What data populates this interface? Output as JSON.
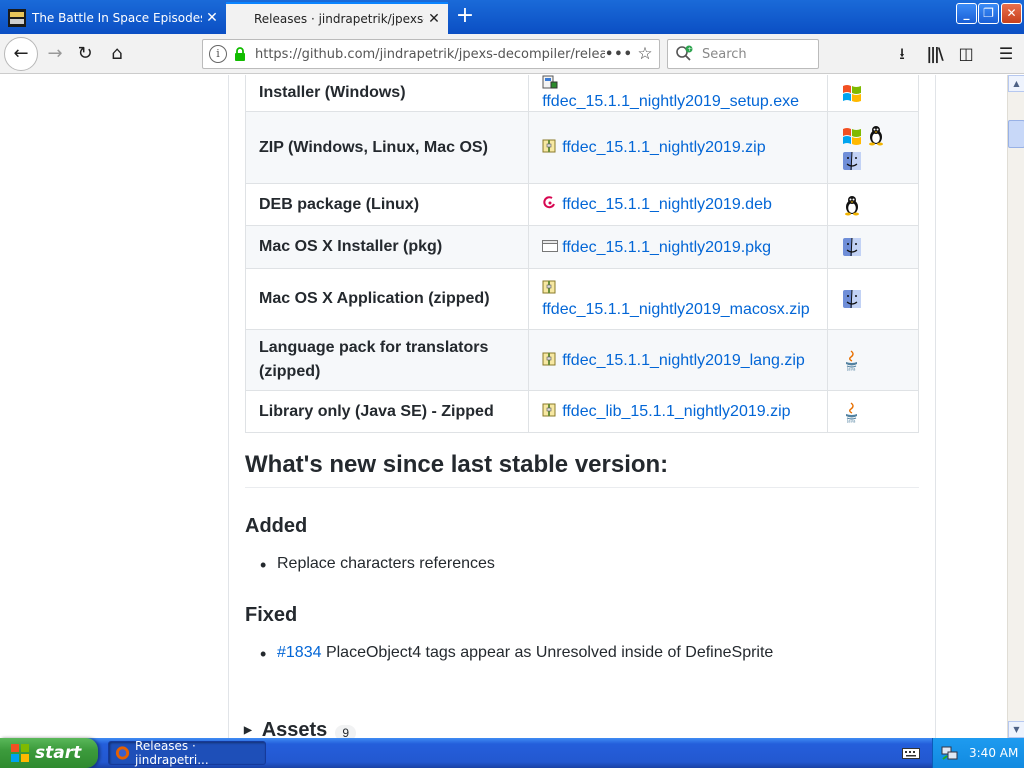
{
  "browser": {
    "tabs": [
      {
        "title": "The Battle In Space Episodes | Ob",
        "active": false
      },
      {
        "title": "Releases · jindrapetrik/jpexs-deco",
        "active": true
      }
    ],
    "url": "https://github.com/jindrapetrik/jpexs-decompiler/relea",
    "search_placeholder": "Search",
    "more_label": "•••"
  },
  "downloads": [
    {
      "label": "Installer (Windows)",
      "file": "ffdec_15.1.1_nightly2019_setup.exe",
      "file_icon": "installer-icon",
      "os_icons": [
        "windows-icon"
      ]
    },
    {
      "label": "ZIP (Windows, Linux, Mac OS)",
      "file": "ffdec_15.1.1_nightly2019.zip",
      "file_icon": "zip-icon",
      "os_icons": [
        "windows-icon",
        "linux-icon",
        "mac-icon"
      ]
    },
    {
      "label": "DEB package (Linux)",
      "file": "ffdec_15.1.1_nightly2019.deb",
      "file_icon": "debian-icon",
      "os_icons": [
        "linux-icon"
      ]
    },
    {
      "label": "Mac OS X Installer (pkg)",
      "file": "ffdec_15.1.1_nightly2019.pkg",
      "file_icon": "pkg-icon",
      "os_icons": [
        "mac-icon"
      ]
    },
    {
      "label": "Mac OS X Application (zipped)",
      "file": "ffdec_15.1.1_nightly2019_macosx.zip",
      "file_icon": "zip-icon",
      "os_icons": [
        "mac-icon"
      ]
    },
    {
      "label": "Language pack for translators (zipped)",
      "file": "ffdec_15.1.1_nightly2019_lang.zip",
      "file_icon": "zip-icon",
      "os_icons": [
        "java-icon"
      ]
    },
    {
      "label": "Library only (Java SE) - Zipped",
      "file": "ffdec_lib_15.1.1_nightly2019.zip",
      "file_icon": "zip-icon",
      "os_icons": [
        "java-icon"
      ]
    }
  ],
  "release_notes": {
    "heading": "What's new since last stable version:",
    "added_heading": "Added",
    "added_items": [
      "Replace characters references"
    ],
    "fixed_heading": "Fixed",
    "fixed_items": [
      {
        "issue": "#1834",
        "text": " PlaceObject4 tags appear as Unresolved inside of DefineSprite"
      }
    ]
  },
  "assets": {
    "label": "Assets",
    "count": "9"
  },
  "taskbar": {
    "start_label": "start",
    "window_item": "Releases · jindrapetri...",
    "clock": "3:40 AM"
  },
  "colors": {
    "link": "#0366d6",
    "titlebar": "#0b4fc4",
    "taskbar": "#245edb",
    "start": "#3c9b3c"
  }
}
